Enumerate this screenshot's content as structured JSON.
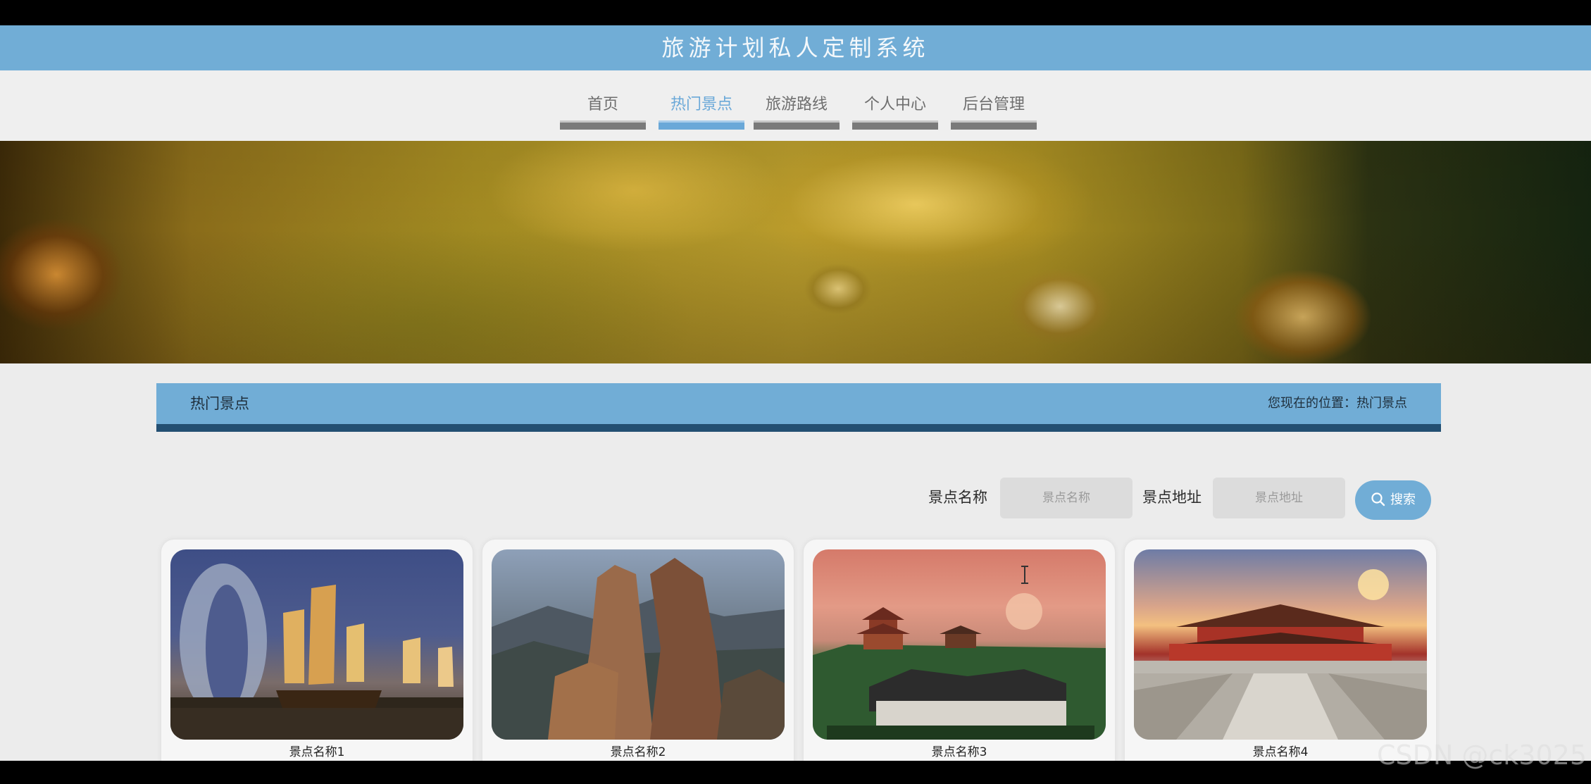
{
  "header": {
    "title": "旅游计划私人定制系统"
  },
  "nav": {
    "items": [
      {
        "label": "首页",
        "active": false
      },
      {
        "label": "热门景点",
        "active": true
      },
      {
        "label": "旅游路线",
        "active": false
      },
      {
        "label": "个人中心",
        "active": false
      },
      {
        "label": "后台管理",
        "active": false
      }
    ]
  },
  "section": {
    "title": "热门景点",
    "breadcrumb": "您现在的位置：热门景点"
  },
  "search": {
    "name_label": "景点名称",
    "name_placeholder": "景点名称",
    "name_value": "",
    "address_label": "景点地址",
    "address_placeholder": "景点地址",
    "address_value": "",
    "button_label": "搜索"
  },
  "attractions": [
    {
      "name": "景点名称1",
      "image": "sailboats-hotel-photo"
    },
    {
      "name": "景点名称2",
      "image": "rock-peaks-photo"
    },
    {
      "name": "景点名称3",
      "image": "pavilion-town-photo"
    },
    {
      "name": "景点名称4",
      "image": "palace-gate-photo"
    }
  ],
  "watermark": "CSDN @ck3025",
  "colors": {
    "accent": "#71add6",
    "accent_dark": "#234f72",
    "nav_bar": "#7a7a7a",
    "page_bg": "#ececec"
  }
}
